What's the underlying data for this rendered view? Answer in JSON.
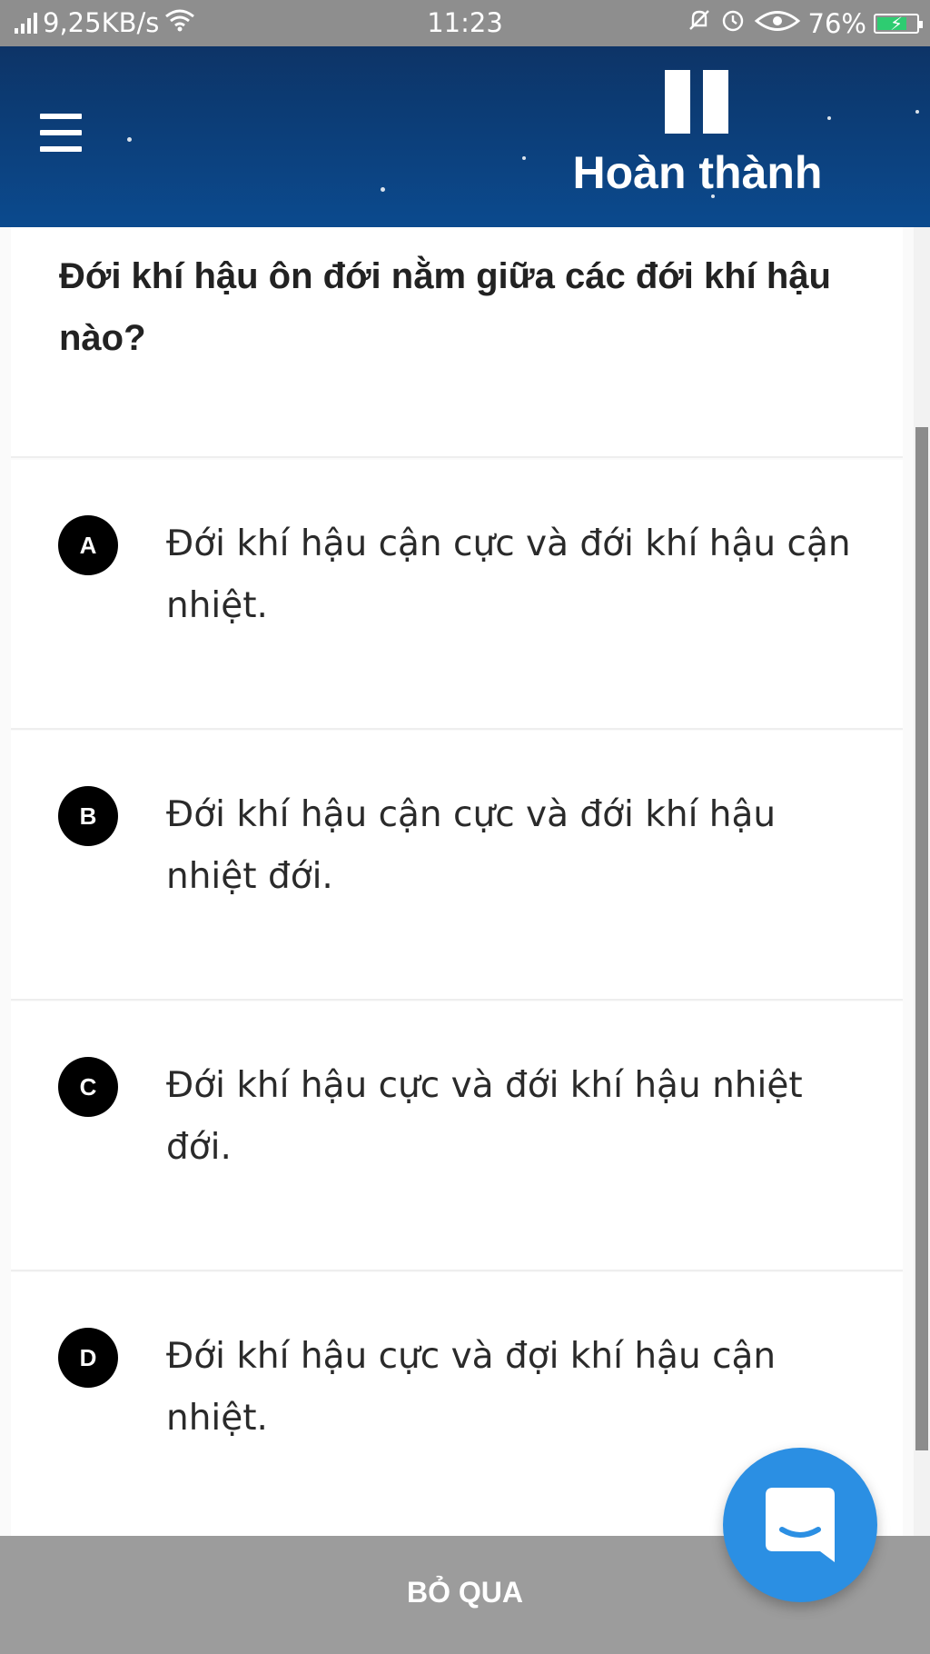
{
  "status_bar": {
    "network_speed": "9,25KB/s",
    "time": "11:23",
    "battery_percent": "76%",
    "battery_level": 0.76,
    "icons": [
      "signal-icon",
      "wifi-icon",
      "mute-icon",
      "alarm-icon",
      "eye-icon",
      "battery-charging-icon"
    ]
  },
  "header": {
    "menu_icon": "hamburger-menu-icon",
    "pause_icon": "pause-icon",
    "finish_label": "Hoàn thành"
  },
  "question": {
    "text": "Đới khí hậu ôn đới nằm giữa các đới khí hậu nào?"
  },
  "options": [
    {
      "letter": "A",
      "text": "Đới khí hậu cận cực và đới khí hậu cận nhiệt."
    },
    {
      "letter": "B",
      "text": "Đới khí hậu cận cực và đới khí hậu nhiệt đới."
    },
    {
      "letter": "C",
      "text": "Đới khí hậu cực và đới khí hậu nhiệt đới."
    },
    {
      "letter": "D",
      "text": "Đới khí hậu cực và đợi khí hậu cận nhiệt."
    }
  ],
  "bottom_bar": {
    "skip_label": "BỎ QUA"
  },
  "chat_fab": {
    "icon": "chat-icon"
  },
  "colors": {
    "status_bar": "#8e8e8e",
    "header_top": "#0d3467",
    "header_bottom": "#0b4a8e",
    "badge": "#000000",
    "bottom_bar": "#9c9c9c",
    "chat_fab": "#2b8fe3",
    "battery_fill": "#2ecc71"
  }
}
